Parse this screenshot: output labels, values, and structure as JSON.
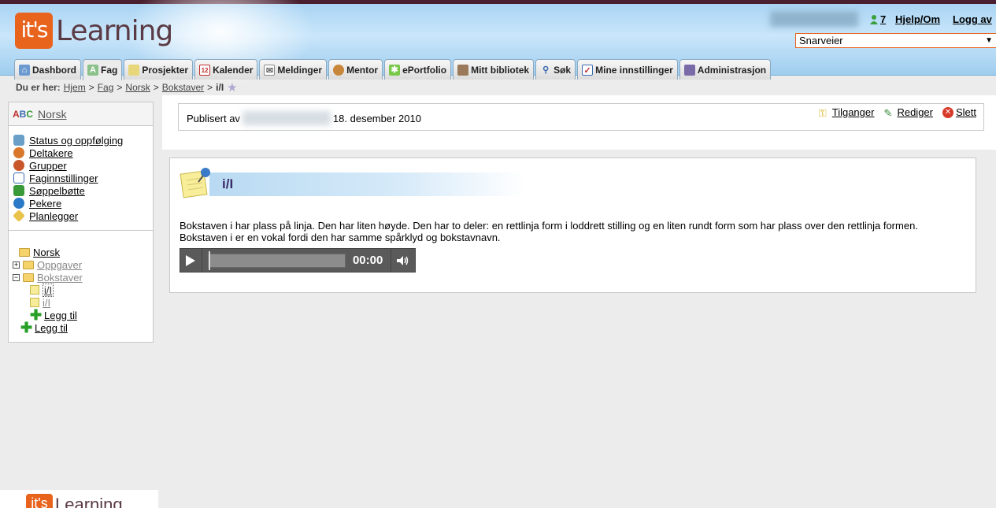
{
  "header": {
    "logo_badge": "it's",
    "logo_word": "Learning",
    "online_count": "7",
    "help_label": "Hjelp/Om",
    "logout_label": "Logg av",
    "shortcuts_value": "Snarveier"
  },
  "tabs": [
    {
      "label": "Dashbord",
      "icon": "home-icon"
    },
    {
      "label": "Fag",
      "icon": "course-icon"
    },
    {
      "label": "Prosjekter",
      "icon": "project-icon"
    },
    {
      "label": "Kalender",
      "icon": "calendar-icon"
    },
    {
      "label": "Meldinger",
      "icon": "message-icon"
    },
    {
      "label": "Mentor",
      "icon": "mentor-icon"
    },
    {
      "label": "ePortfolio",
      "icon": "portfolio-icon"
    },
    {
      "label": "Mitt bibliotek",
      "icon": "library-icon"
    },
    {
      "label": "Søk",
      "icon": "search-icon"
    },
    {
      "label": "Mine innstillinger",
      "icon": "settings-icon"
    },
    {
      "label": "Administrasjon",
      "icon": "admin-icon"
    }
  ],
  "breadcrumb": {
    "label": "Du er her:",
    "items": [
      "Hjem",
      "Fag",
      "Norsk",
      "Bokstaver"
    ],
    "current": "i/I"
  },
  "sidebar": {
    "course_title": "Norsk",
    "menu": [
      {
        "label": "Status og oppfølging",
        "icon": "status-icon",
        "color": "#6aa0c8"
      },
      {
        "label": "Deltakere",
        "icon": "participants-icon",
        "color": "#d9772a"
      },
      {
        "label": "Grupper",
        "icon": "groups-icon",
        "color": "#c8562a"
      },
      {
        "label": "Faginnstillinger",
        "icon": "course-settings-icon",
        "color": "#c03030"
      },
      {
        "label": "Søppelbøtte",
        "icon": "trash-icon",
        "color": "#3a9a3a"
      },
      {
        "label": "Pekere",
        "icon": "globe-icon",
        "color": "#2a7ac8"
      },
      {
        "label": "Planlegger",
        "icon": "planner-icon",
        "color": "#e8c24a"
      }
    ],
    "tree": {
      "root": "Norsk",
      "folder1": "Oppgaver",
      "folder2": "Bokstaver",
      "item1": "i/I",
      "item2": "i/I",
      "add_inner": "Legg til",
      "add_outer": "Legg til"
    }
  },
  "footer": {
    "logo_badge": "it's",
    "logo_word": "Learning"
  },
  "meta": {
    "published_by": "Publisert av",
    "date": "18. desember 2010"
  },
  "actions": {
    "access": "Tilganger",
    "edit": "Rediger",
    "delete": "Slett"
  },
  "content": {
    "title": "i/I",
    "body_line1": "Bokstaven i har plass på linja. Den har liten høyde. Den har to deler: en rettlinja form i loddrett stilling og en liten rundt form som har plass over den rettlinja formen.",
    "body_line2": "Bokstaven i er en vokal fordi den har samme spårklyd og bokstavnavn.",
    "player_time": "00:00",
    "player_progress": 0
  }
}
